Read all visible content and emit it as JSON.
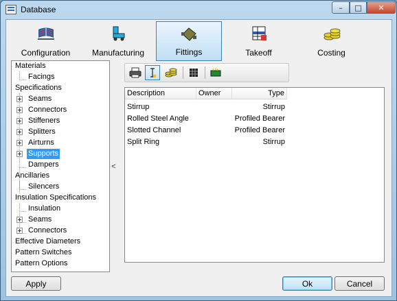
{
  "window": {
    "title": "Database",
    "min_glyph": "–",
    "max_glyph": "□",
    "close_glyph": "✕"
  },
  "topbar": {
    "buttons": [
      {
        "label": "Configuration",
        "icon": "configuration-icon",
        "active": false
      },
      {
        "label": "Manufacturing",
        "icon": "manufacturing-icon",
        "active": false
      },
      {
        "label": "Fittings",
        "icon": "fittings-icon",
        "active": true
      },
      {
        "label": "Takeoff",
        "icon": "takeoff-icon",
        "active": false
      },
      {
        "label": "Costing",
        "icon": "costing-icon",
        "active": false
      }
    ]
  },
  "tree": {
    "items": [
      {
        "label": "Materials"
      },
      {
        "label": "Facings"
      },
      {
        "label": "Specifications"
      },
      {
        "label": "Seams"
      },
      {
        "label": "Connectors"
      },
      {
        "label": "Stiffeners"
      },
      {
        "label": "Splitters"
      },
      {
        "label": "Airturns"
      },
      {
        "label": "Supports",
        "selected": true
      },
      {
        "label": "Dampers"
      },
      {
        "label": "Ancillaries"
      },
      {
        "label": "Silencers"
      },
      {
        "label": "Insulation Specifications"
      },
      {
        "label": "Insulation"
      },
      {
        "label": "Seams"
      },
      {
        "label": "Connectors"
      },
      {
        "label": "Effective Diameters"
      },
      {
        "label": "Pattern Switches"
      },
      {
        "label": "Pattern Options"
      }
    ]
  },
  "splitter": {
    "glyph": "<"
  },
  "toolbar": {
    "tools": [
      "print-icon",
      "text-cursor-icon",
      "coins-icon",
      "grid-icon",
      "new-item-icon"
    ],
    "active_tool": "text-cursor-icon"
  },
  "list": {
    "columns": [
      "Description",
      "Owner",
      "Type"
    ],
    "rows": [
      {
        "description": "Stirrup",
        "owner": "",
        "type": "Stirrup"
      },
      {
        "description": "Rolled Steel Angle",
        "owner": "",
        "type": "Profiled Bearer"
      },
      {
        "description": "Slotted Channel",
        "owner": "",
        "type": "Profiled Bearer"
      },
      {
        "description": "Split Ring",
        "owner": "",
        "type": "Stirrup"
      }
    ]
  },
  "buttons": {
    "apply": "Apply",
    "ok": "Ok",
    "cancel": "Cancel"
  }
}
